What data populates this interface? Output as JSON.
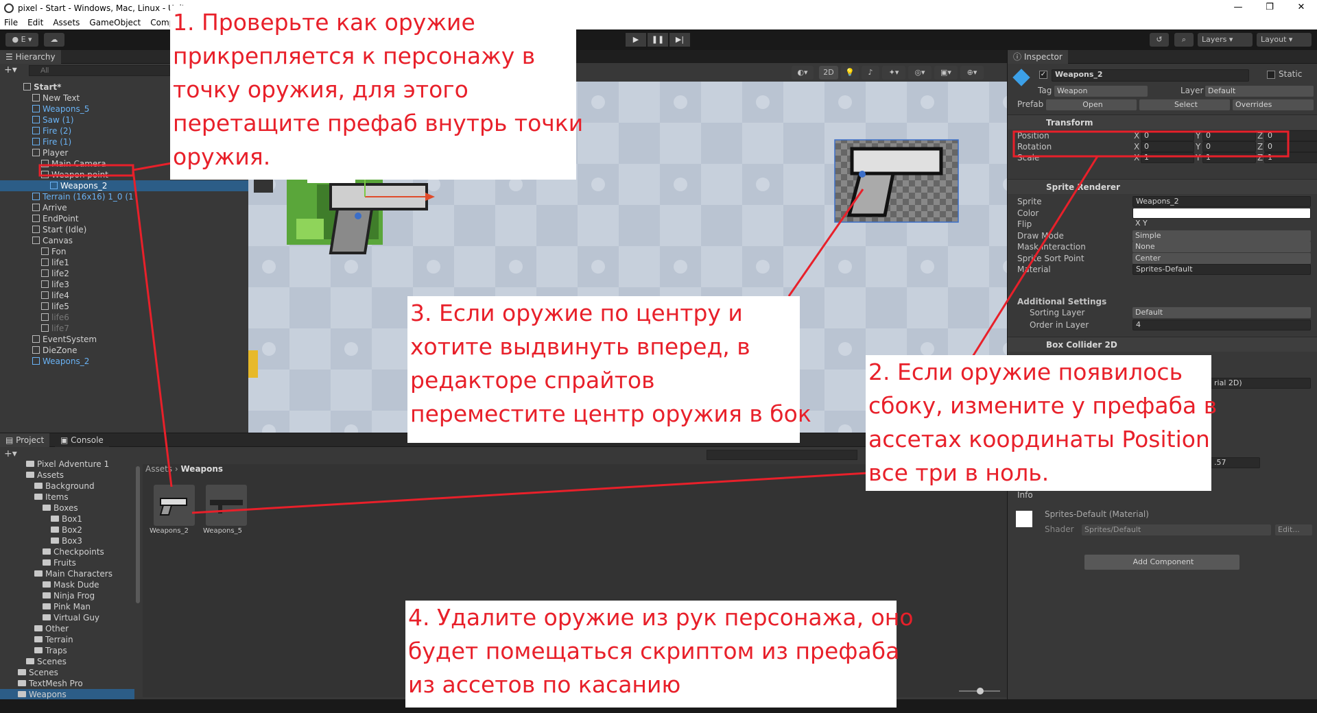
{
  "window": {
    "title": "pixel - Start - Windows, Mac, Linux - Unity",
    "controls": [
      "—",
      "❐",
      "✕"
    ]
  },
  "menu": [
    "File",
    "Edit",
    "Assets",
    "GameObject",
    "Compon"
  ],
  "toolbar": {
    "account": "E",
    "layers": "Layers",
    "layout": "Layout"
  },
  "hierarchy": {
    "tab": "Hierarchy",
    "search_placeholder": "All",
    "items": [
      {
        "label": "Start*",
        "indent": 0,
        "kind": "scene"
      },
      {
        "label": "New Text",
        "indent": 1,
        "kind": "obj"
      },
      {
        "label": "Weapons_5",
        "indent": 1,
        "kind": "prefab"
      },
      {
        "label": "Saw (1)",
        "indent": 1,
        "kind": "prefab"
      },
      {
        "label": "Fire (2)",
        "indent": 1,
        "kind": "prefab"
      },
      {
        "label": "Fire (1)",
        "indent": 1,
        "kind": "prefab"
      },
      {
        "label": "Player",
        "indent": 1,
        "kind": "obj"
      },
      {
        "label": "Main Camera",
        "indent": 2,
        "kind": "obj"
      },
      {
        "label": "Weapon point",
        "indent": 2,
        "kind": "obj"
      },
      {
        "label": "Weapons_2",
        "indent": 3,
        "kind": "selected"
      },
      {
        "label": "Terrain (16x16) 1_0 (1",
        "indent": 1,
        "kind": "prefab"
      },
      {
        "label": "Arrive",
        "indent": 1,
        "kind": "obj"
      },
      {
        "label": "EndPoint",
        "indent": 1,
        "kind": "obj"
      },
      {
        "label": "Start (Idle)",
        "indent": 1,
        "kind": "obj"
      },
      {
        "label": "Canvas",
        "indent": 1,
        "kind": "obj"
      },
      {
        "label": "Fon",
        "indent": 2,
        "kind": "obj"
      },
      {
        "label": "life1",
        "indent": 2,
        "kind": "obj"
      },
      {
        "label": "life2",
        "indent": 2,
        "kind": "obj"
      },
      {
        "label": "life3",
        "indent": 2,
        "kind": "obj"
      },
      {
        "label": "life4",
        "indent": 2,
        "kind": "obj"
      },
      {
        "label": "life5",
        "indent": 2,
        "kind": "obj"
      },
      {
        "label": "life6",
        "indent": 2,
        "kind": "dim"
      },
      {
        "label": "life7",
        "indent": 2,
        "kind": "dim"
      },
      {
        "label": "EventSystem",
        "indent": 1,
        "kind": "obj"
      },
      {
        "label": "DieZone",
        "indent": 1,
        "kind": "obj"
      },
      {
        "label": "Weapons_2",
        "indent": 1,
        "kind": "prefab"
      }
    ]
  },
  "scene": {
    "mode_2d": "2D"
  },
  "inspector": {
    "tab": "Inspector",
    "name": "Weapons_2",
    "static_label": "Static",
    "tag_label": "Tag",
    "tag_value": "Weapon",
    "layer_label": "Layer",
    "layer_value": "Default",
    "prefab_label": "Prefab",
    "prefab_open": "Open",
    "prefab_select": "Select",
    "prefab_overrides": "Overrides",
    "transform": {
      "title": "Transform",
      "rows": [
        {
          "label": "Position",
          "x": "0",
          "y": "0",
          "z": "0"
        },
        {
          "label": "Rotation",
          "x": "0",
          "y": "0",
          "z": "0"
        },
        {
          "label": "Scale",
          "x": "1",
          "y": "1",
          "z": "1"
        }
      ]
    },
    "sprite_renderer": {
      "title": "Sprite Renderer",
      "rows": [
        {
          "label": "Sprite",
          "value": "Weapons_2"
        },
        {
          "label": "Color",
          "value": ""
        },
        {
          "label": "Flip",
          "value": "X  Y"
        },
        {
          "label": "Draw Mode",
          "value": "Simple"
        },
        {
          "label": "Mask Interaction",
          "value": "None"
        },
        {
          "label": "Sprite Sort Point",
          "value": "Center"
        },
        {
          "label": "Material",
          "value": "Sprites-Default"
        }
      ],
      "additional": "Additional Settings",
      "sorting_layer_label": "Sorting Layer",
      "sorting_layer_value": "Default",
      "order_label": "Order in Layer",
      "order_value": "4"
    },
    "box_collider": {
      "title": "Box Collider 2D",
      "partial_value": "rial 2D)",
      "partial_num": ".57",
      "info": "Info"
    },
    "material": {
      "name": "Sprites-Default (Material)",
      "shader_label": "Shader",
      "shader_value": "Sprites/Default",
      "edit": "Edit..."
    },
    "add_component": "Add Component"
  },
  "project": {
    "tabs": [
      "Project",
      "Console"
    ],
    "breadcrumb": [
      "Assets",
      "Weapons"
    ],
    "tree": [
      {
        "label": "Pixel Adventure 1",
        "indent": 2
      },
      {
        "label": "Assets",
        "indent": 2
      },
      {
        "label": "Background",
        "indent": 3
      },
      {
        "label": "Items",
        "indent": 3
      },
      {
        "label": "Boxes",
        "indent": 4
      },
      {
        "label": "Box1",
        "indent": 5
      },
      {
        "label": "Box2",
        "indent": 5
      },
      {
        "label": "Box3",
        "indent": 5
      },
      {
        "label": "Checkpoints",
        "indent": 4
      },
      {
        "label": "Fruits",
        "indent": 4
      },
      {
        "label": "Main Characters",
        "indent": 3
      },
      {
        "label": "Mask Dude",
        "indent": 4
      },
      {
        "label": "Ninja Frog",
        "indent": 4
      },
      {
        "label": "Pink Man",
        "indent": 4
      },
      {
        "label": "Virtual Guy",
        "indent": 4
      },
      {
        "label": "Other",
        "indent": 3
      },
      {
        "label": "Terrain",
        "indent": 3
      },
      {
        "label": "Traps",
        "indent": 3
      },
      {
        "label": "Scenes",
        "indent": 2
      },
      {
        "label": "Scenes",
        "indent": 1
      },
      {
        "label": "TextMesh Pro",
        "indent": 1
      },
      {
        "label": "Weapons",
        "indent": 1
      }
    ],
    "assets": [
      "Weapons_2",
      "Weapons_5"
    ]
  },
  "notes": {
    "n1": [
      "1. Проверьте как оружие",
      "прикрепляется к персонажу в",
      "точку оружия, для этого",
      "перетащите префаб внутрь точки",
      "оружия."
    ],
    "n2": [
      "2. Если оружие появилось",
      "сбоку, измените у префаба в",
      "ассетах координаты Position",
      "все три в ноль."
    ],
    "n3": [
      "3. Если оружие по центру и",
      "хотите выдвинуть вперед, в",
      "редакторе спрайтов",
      "переместите центр оружия в бок"
    ],
    "n4": [
      "4. Удалите оружие из рук персонажа, оно",
      "будет помещаться скриптом из префаба",
      "из ассетов по касанию"
    ]
  },
  "colors": {
    "annotation": "#e8202a",
    "prefab": "#6ab3f5",
    "selection": "#2c5d87"
  }
}
